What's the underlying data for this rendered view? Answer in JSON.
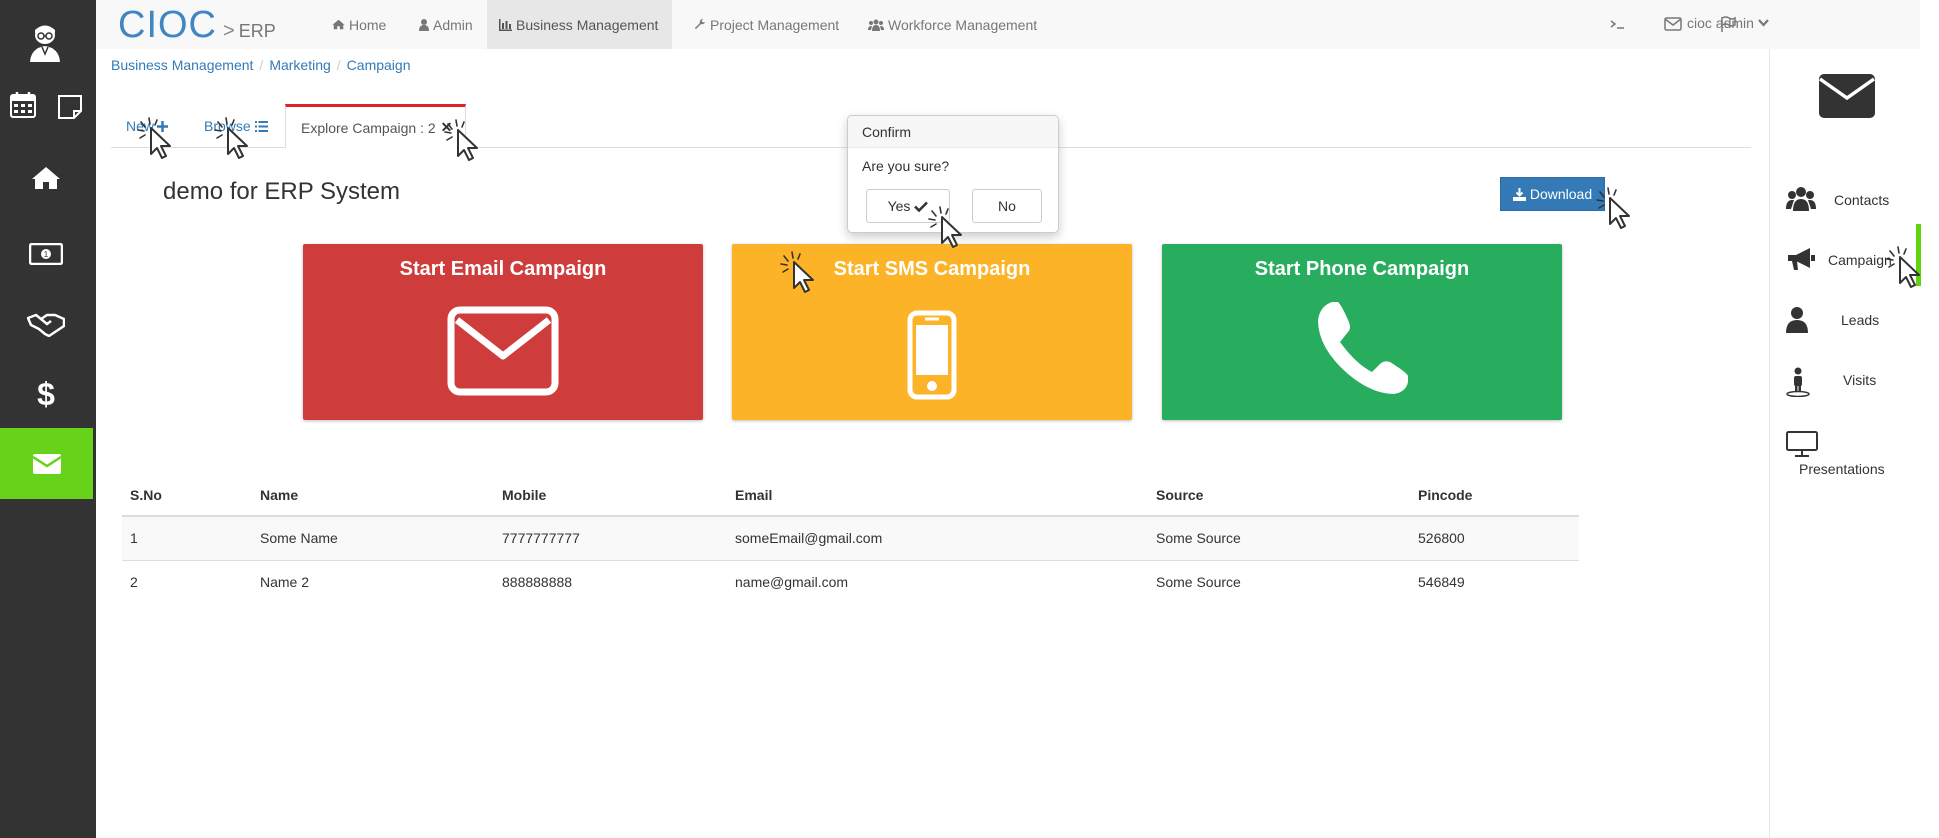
{
  "navbar": {
    "brand_name": "CIOC",
    "brand_separator": ">",
    "brand_suffix": "ERP",
    "items": [
      {
        "label": "Home",
        "icon": "home-icon"
      },
      {
        "label": "Admin",
        "icon": "user-icon"
      },
      {
        "label": "Business Management",
        "icon": "chart-icon",
        "active": true
      },
      {
        "label": "Project Management",
        "icon": "wrench-icon"
      },
      {
        "label": "Workforce Management",
        "icon": "users-icon"
      }
    ],
    "right_icons": [
      "terminal-icon",
      "envelope-icon",
      "flag-icon"
    ],
    "user_name": "cioc admin"
  },
  "left_sidebar": {
    "items": [
      "avatar-icon",
      "calendar-icon",
      "sticky-note-icon",
      "home-icon",
      "money-icon",
      "handshake-icon",
      "dollar-icon",
      "envelope-icon"
    ],
    "active_color": "#66d21a"
  },
  "breadcrumb": [
    "Business Management",
    "Marketing",
    "Campaign"
  ],
  "tabs": {
    "new_label": "New",
    "browse_label": "Browse",
    "explore_label": "Explore Campaign : 2"
  },
  "page_title": "demo for ERP System",
  "download_label": "Download",
  "cards": [
    {
      "title": "Start Email Campaign",
      "color": "#cf3c3c",
      "icon": "envelope-icon"
    },
    {
      "title": "Start SMS Campaign",
      "color": "#fdb327",
      "icon": "mobile-phone-icon"
    },
    {
      "title": "Start Phone Campaign",
      "color": "#28ad5f",
      "icon": "phone-icon"
    }
  ],
  "table": {
    "headers": [
      "S.No",
      "Name",
      "Mobile",
      "Email",
      "Source",
      "Pincode"
    ],
    "rows": [
      [
        "1",
        "Some Name",
        "7777777777",
        "someEmail@gmail.com",
        "Some Source",
        "526800"
      ],
      [
        "2",
        "Name 2",
        "888888888",
        "name@gmail.com",
        "Some Source",
        "546849"
      ]
    ]
  },
  "confirm_popover": {
    "title": "Confirm",
    "message": "Are you sure?",
    "yes_label": "Yes",
    "no_label": "No"
  },
  "right_sidebar": {
    "items": [
      {
        "label": "Contacts",
        "icon": "users-icon"
      },
      {
        "label": "Campaign",
        "icon": "bullhorn-icon"
      },
      {
        "label": "Leads",
        "icon": "user-icon"
      },
      {
        "label": "Visits",
        "icon": "street-view-icon"
      },
      {
        "label": "Presentations",
        "icon": "desktop-icon"
      }
    ]
  }
}
